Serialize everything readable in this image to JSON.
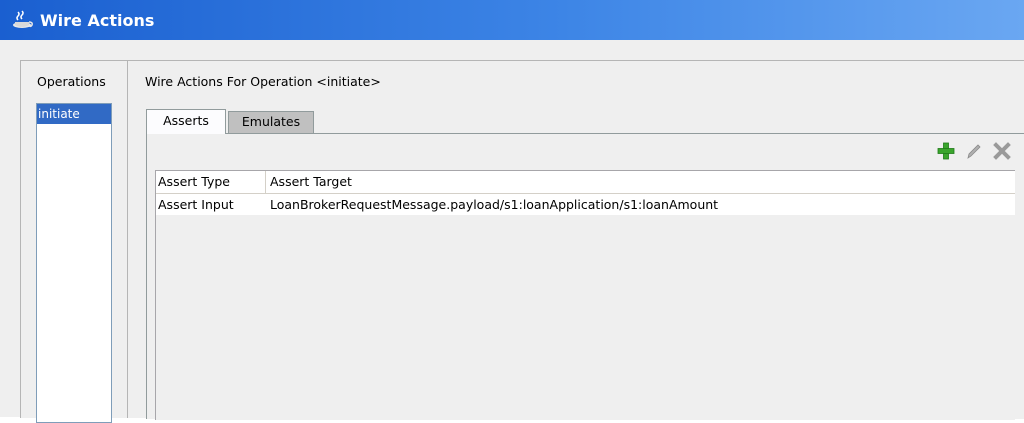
{
  "window": {
    "title": "Wire Actions",
    "icon": "coffee-cup-icon"
  },
  "operations": {
    "label": "Operations",
    "items": [
      {
        "label": "initiate",
        "selected": true
      }
    ]
  },
  "main": {
    "heading": "Wire Actions For Operation <initiate>",
    "tabs": [
      {
        "label": "Asserts",
        "active": true
      },
      {
        "label": "Emulates",
        "active": false
      }
    ],
    "toolbar": [
      {
        "icon": "add-icon",
        "color": "#3aa52c"
      },
      {
        "icon": "edit-pencil-icon",
        "color": "#9a9a9a"
      },
      {
        "icon": "delete-x-icon",
        "color": "#9a9a9a"
      }
    ],
    "table": {
      "columns": [
        "Assert Type",
        "Assert Target"
      ],
      "rows": [
        [
          "Assert Input",
          "LoanBrokerRequestMessage.payload/s1:loanApplication/s1:loanAmount"
        ]
      ]
    }
  },
  "colors": {
    "titlebar": "#2a6fdc",
    "selection": "#316ac5",
    "background": "#efefef"
  }
}
